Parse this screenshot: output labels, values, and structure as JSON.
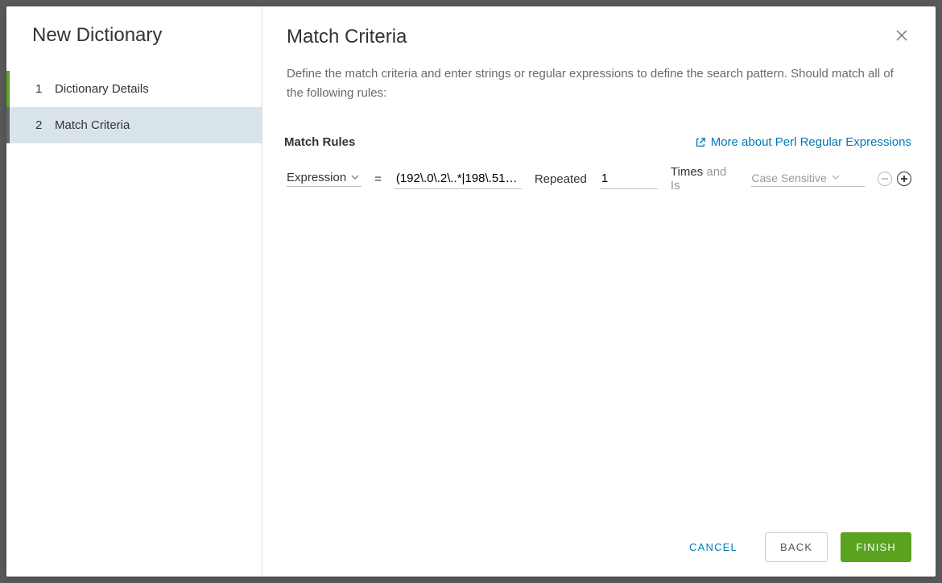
{
  "sidebar": {
    "title": "New Dictionary",
    "steps": [
      {
        "num": "1",
        "label": "Dictionary Details"
      },
      {
        "num": "2",
        "label": "Match Criteria"
      }
    ]
  },
  "header": {
    "title": "Match Criteria"
  },
  "description": "Define the match criteria and enter strings or regular expressions to define the search pattern. Should match all of the following rules:",
  "rules": {
    "section_label": "Match Rules",
    "help_link": "More about Perl Regular Expressions",
    "row": {
      "type_value": "Expression",
      "equals": "=",
      "value": "(192\\.0\\.2\\..*|198\\.51\\.1…",
      "repeated_label": "Repeated",
      "count": "1",
      "times_label": "Times",
      "and_is": "and Is",
      "case_placeholder": "Case Sensitive"
    }
  },
  "footer": {
    "cancel": "CANCEL",
    "back": "BACK",
    "finish": "FINISH"
  }
}
